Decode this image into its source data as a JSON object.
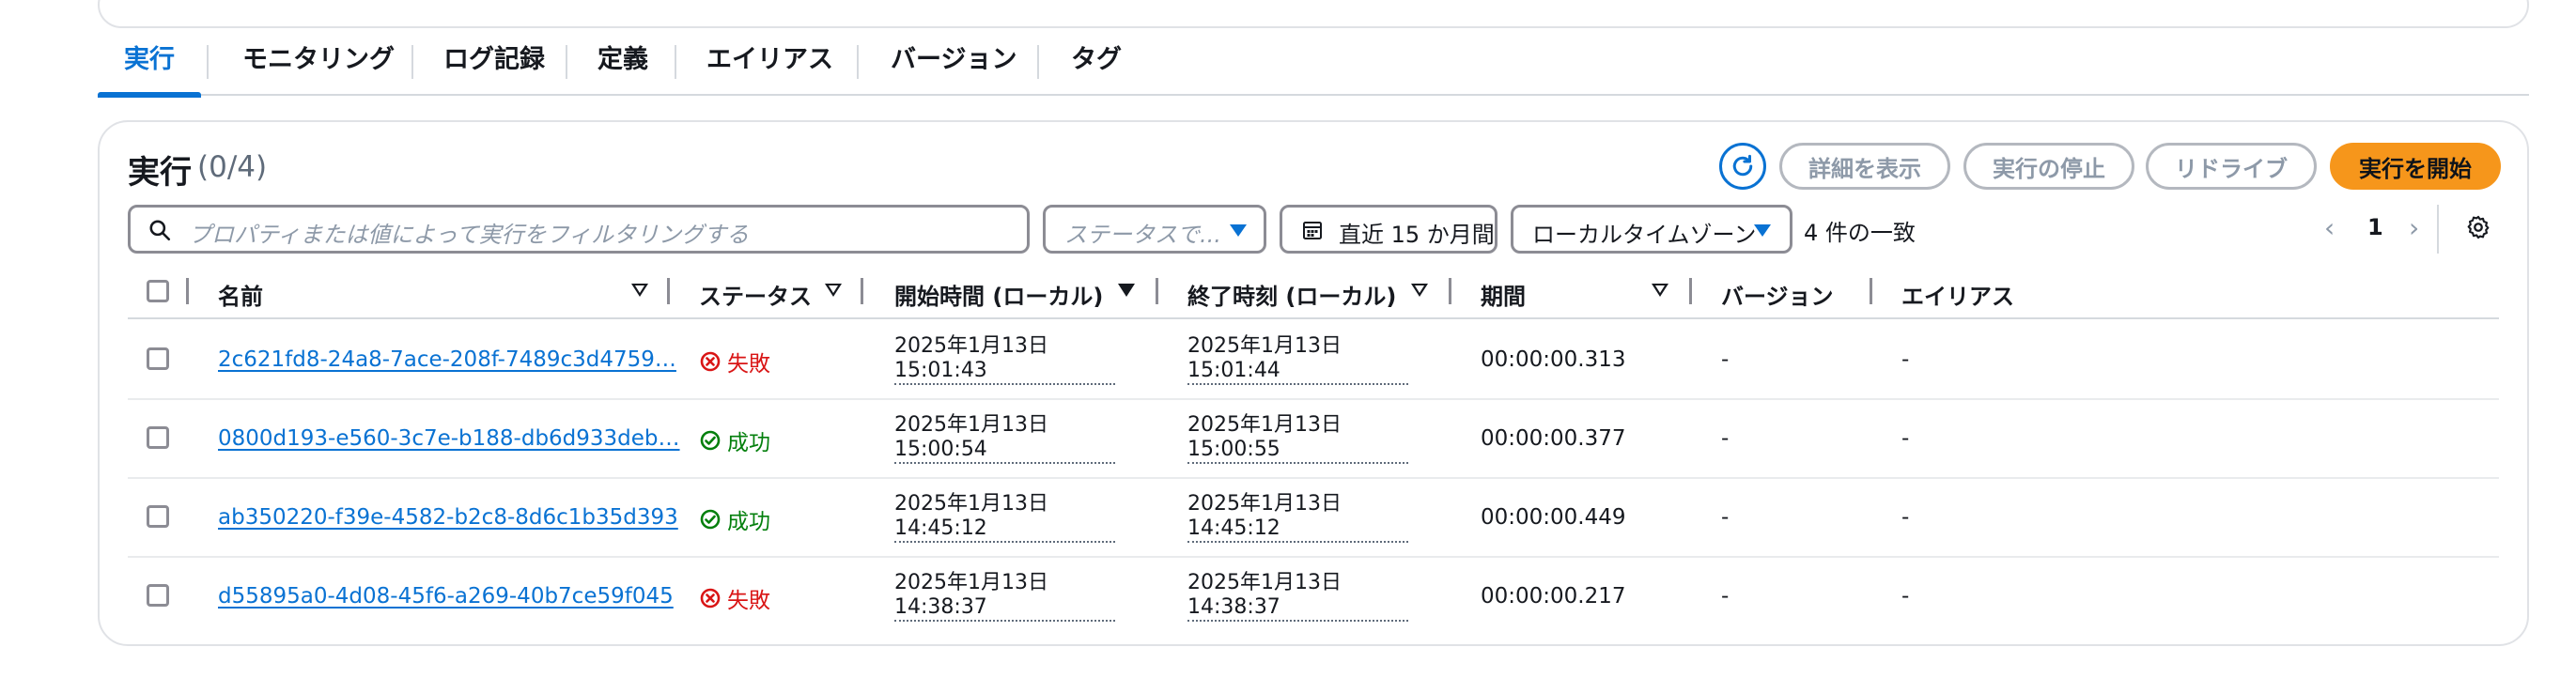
{
  "tabs": [
    {
      "label": "実行",
      "active": true
    },
    {
      "label": "モニタリング"
    },
    {
      "label": "ログ記録"
    },
    {
      "label": "定義"
    },
    {
      "label": "エイリアス"
    },
    {
      "label": "バージョン"
    },
    {
      "label": "タグ"
    }
  ],
  "panel": {
    "title": "実行",
    "count": "(0/4)",
    "buttons": {
      "refresh_icon": "refresh-icon",
      "details": "詳細を表示",
      "stop": "実行の停止",
      "redrive": "リドライブ",
      "start": "実行を開始"
    }
  },
  "filter": {
    "search_placeholder": "プロパティまたは値によって実行をフィルタリングする",
    "status_placeholder": "ステータスで...",
    "date_range": "直近 15 か月間",
    "timezone": "ローカルタイムゾーン",
    "match_text": "4 件の一致"
  },
  "pagination": {
    "page": "1",
    "prev": "‹",
    "next": "›"
  },
  "table": {
    "headers": {
      "name": "名前",
      "status": "ステータス",
      "start": "開始時間 (ローカル)",
      "end": "終了時刻 (ローカル)",
      "duration": "期間",
      "version": "バージョン",
      "alias": "エイリアス"
    },
    "rows": [
      {
        "name": "2c621fd8-24a8-7ace-208f-7489c3d4759…",
        "status": "失敗",
        "status_type": "fail",
        "start_date": "2025年1月13日",
        "start_time": "15:01:43",
        "end_date": "2025年1月13日",
        "end_time": "15:01:44",
        "duration": "00:00:00.313",
        "version": "-",
        "alias": "-"
      },
      {
        "name": "0800d193-e560-3c7e-b188-db6d933deb…",
        "status": "成功",
        "status_type": "ok",
        "start_date": "2025年1月13日",
        "start_time": "15:00:54",
        "end_date": "2025年1月13日",
        "end_time": "15:00:55",
        "duration": "00:00:00.377",
        "version": "-",
        "alias": "-"
      },
      {
        "name": "ab350220-f39e-4582-b2c8-8d6c1b35d393",
        "status": "成功",
        "status_type": "ok",
        "start_date": "2025年1月13日",
        "start_time": "14:45:12",
        "end_date": "2025年1月13日",
        "end_time": "14:45:12",
        "duration": "00:00:00.449",
        "version": "-",
        "alias": "-"
      },
      {
        "name": "d55895a0-4d08-45f6-a269-40b7ce59f045",
        "status": "失敗",
        "status_type": "fail",
        "start_date": "2025年1月13日",
        "start_time": "14:38:37",
        "end_date": "2025年1月13日",
        "end_time": "14:38:37",
        "duration": "00:00:00.217",
        "version": "-",
        "alias": "-"
      }
    ]
  },
  "colors": {
    "accent": "#0972d3",
    "primary": "#f6961b",
    "fail": "#d91515",
    "ok": "#037f0c"
  }
}
